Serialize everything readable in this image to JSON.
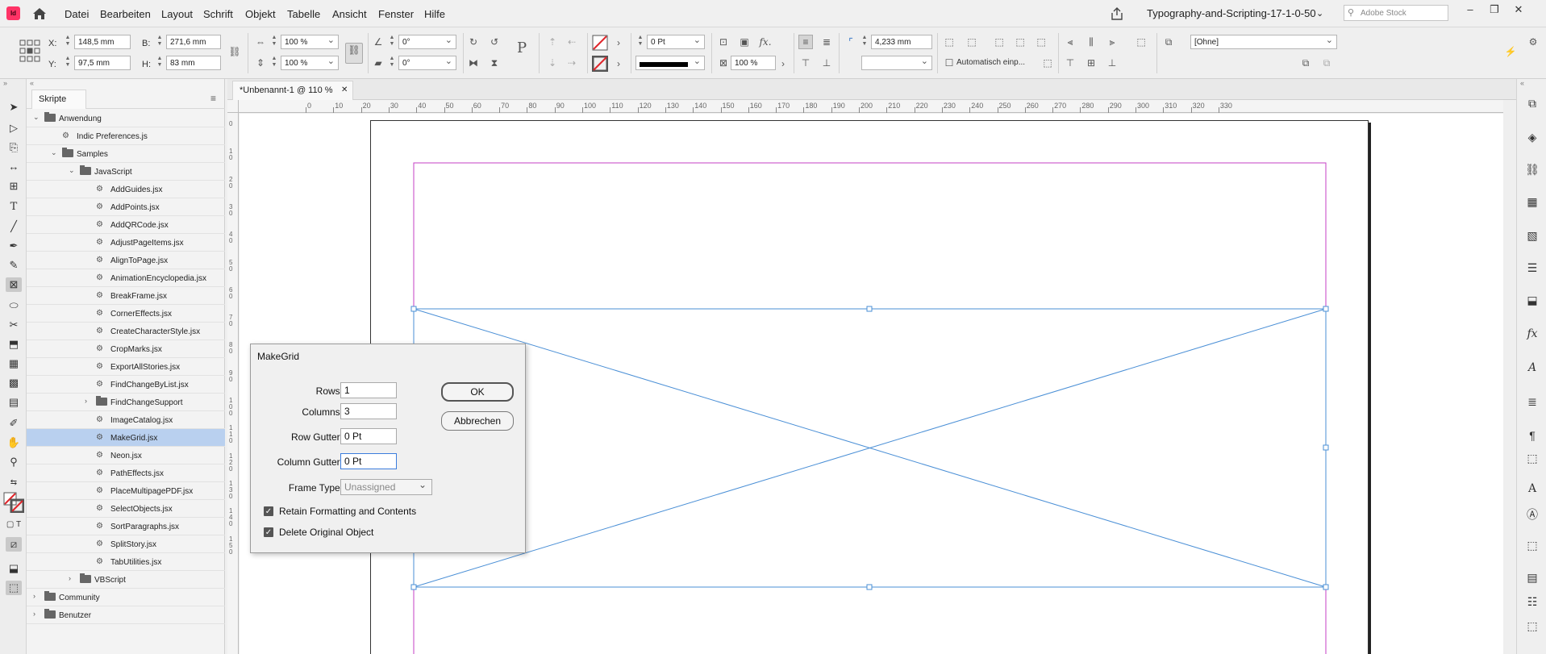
{
  "menubar": {
    "app_badge": "Id",
    "items": [
      "Datei",
      "Bearbeiten",
      "Layout",
      "Schrift",
      "Objekt",
      "Tabelle",
      "Ansicht",
      "Fenster",
      "Hilfe"
    ],
    "workspace": "Typography-and-Scripting-17-1-0-50",
    "search_placeholder": "Adobe Stock"
  },
  "control": {
    "x_label": "X:",
    "x_value": "148,5 mm",
    "y_label": "Y:",
    "y_value": "97,5 mm",
    "b_label": "B:",
    "b_value": "271,6 mm",
    "h_label": "H:",
    "h_value": "83 mm",
    "scale_x": "100 %",
    "scale_y": "100 %",
    "rotate": "0°",
    "shear": "0°",
    "stroke_weight": "0 Pt",
    "opacity": "100 %",
    "corner_value": "4,233 mm",
    "auto_fit": "Automatisch einp...",
    "style": "[Ohne]"
  },
  "scripts_panel": {
    "tab": "Skripte",
    "items": [
      {
        "label": "Anwendung",
        "level": 0,
        "kind": "folder",
        "arrow": "⌄"
      },
      {
        "label": "Indic Preferences.js",
        "level": 1,
        "kind": "script",
        "arrow": ""
      },
      {
        "label": "Samples",
        "level": 1,
        "kind": "folder",
        "arrow": "⌄"
      },
      {
        "label": "JavaScript",
        "level": 2,
        "kind": "folder",
        "arrow": "⌄"
      },
      {
        "label": "AddGuides.jsx",
        "level": 3,
        "kind": "script",
        "arrow": ""
      },
      {
        "label": "AddPoints.jsx",
        "level": 3,
        "kind": "script",
        "arrow": ""
      },
      {
        "label": "AddQRCode.jsx",
        "level": 3,
        "kind": "script",
        "arrow": ""
      },
      {
        "label": "AdjustPageItems.jsx",
        "level": 3,
        "kind": "script",
        "arrow": ""
      },
      {
        "label": "AlignToPage.jsx",
        "level": 3,
        "kind": "script",
        "arrow": ""
      },
      {
        "label": "AnimationEncyclopedia.jsx",
        "level": 3,
        "kind": "script",
        "arrow": ""
      },
      {
        "label": "BreakFrame.jsx",
        "level": 3,
        "kind": "script",
        "arrow": ""
      },
      {
        "label": "CornerEffects.jsx",
        "level": 3,
        "kind": "script",
        "arrow": ""
      },
      {
        "label": "CreateCharacterStyle.jsx",
        "level": 3,
        "kind": "script",
        "arrow": ""
      },
      {
        "label": "CropMarks.jsx",
        "level": 3,
        "kind": "script",
        "arrow": ""
      },
      {
        "label": "ExportAllStories.jsx",
        "level": 3,
        "kind": "script",
        "arrow": ""
      },
      {
        "label": "FindChangeByList.jsx",
        "level": 3,
        "kind": "script",
        "arrow": ""
      },
      {
        "label": "FindChangeSupport",
        "level": 3,
        "kind": "folder",
        "arrow": "›"
      },
      {
        "label": "ImageCatalog.jsx",
        "level": 3,
        "kind": "script",
        "arrow": ""
      },
      {
        "label": "MakeGrid.jsx",
        "level": 3,
        "kind": "script",
        "arrow": "",
        "selected": true
      },
      {
        "label": "Neon.jsx",
        "level": 3,
        "kind": "script",
        "arrow": ""
      },
      {
        "label": "PathEffects.jsx",
        "level": 3,
        "kind": "script",
        "arrow": ""
      },
      {
        "label": "PlaceMultipagePDF.jsx",
        "level": 3,
        "kind": "script",
        "arrow": ""
      },
      {
        "label": "SelectObjects.jsx",
        "level": 3,
        "kind": "script",
        "arrow": ""
      },
      {
        "label": "SortParagraphs.jsx",
        "level": 3,
        "kind": "script",
        "arrow": ""
      },
      {
        "label": "SplitStory.jsx",
        "level": 3,
        "kind": "script",
        "arrow": ""
      },
      {
        "label": "TabUtilities.jsx",
        "level": 3,
        "kind": "script",
        "arrow": ""
      },
      {
        "label": "VBScript",
        "level": 2,
        "kind": "folder",
        "arrow": "›"
      },
      {
        "label": "Community",
        "level": 0,
        "kind": "folder",
        "arrow": "›"
      },
      {
        "label": "Benutzer",
        "level": 0,
        "kind": "folder",
        "arrow": "›"
      }
    ]
  },
  "document": {
    "tab_title": "*Unbenannt-1 @ 110 %",
    "close_glyph": "✕",
    "ruler_h": [
      "0",
      "10",
      "20",
      "30",
      "40",
      "50",
      "60",
      "70",
      "80",
      "90",
      "100",
      "110",
      "120",
      "130",
      "140",
      "150",
      "160",
      "170",
      "180",
      "190",
      "200",
      "210",
      "220",
      "230",
      "240",
      "250",
      "260",
      "270",
      "280",
      "290",
      "300",
      "310",
      "320",
      "330"
    ],
    "ruler_v": [
      "0",
      "1 0",
      "2 0",
      "3 0",
      "4 0",
      "5 0",
      "6 0",
      "7 0",
      "8 0",
      "9 0",
      "1 0 0",
      "1 1 0",
      "1 2 0",
      "1 3 0",
      "1 4 0",
      "1 5 0"
    ]
  },
  "dialog": {
    "title": "MakeGrid",
    "rows_label": "Rows:",
    "rows_value": "1",
    "columns_label": "Columns:",
    "columns_value": "3",
    "row_gutter_label": "Row Gutter:",
    "row_gutter_value": "0 Pt",
    "column_gutter_label": "Column Gutter:",
    "column_gutter_value": "0 Pt",
    "frame_type_label": "Frame Type:",
    "frame_type_value": "Unassigned",
    "retain_label": "Retain Formatting and Contents",
    "retain_checked": true,
    "delete_label": "Delete Original Object",
    "delete_checked": true,
    "ok_label": "OK",
    "cancel_label": "Abbrechen"
  },
  "colors": {
    "accent": "#ff3366",
    "selection": "#4a8fd6",
    "margin_guide": "#c43fc4",
    "selected_row": "#b9d0ef"
  }
}
